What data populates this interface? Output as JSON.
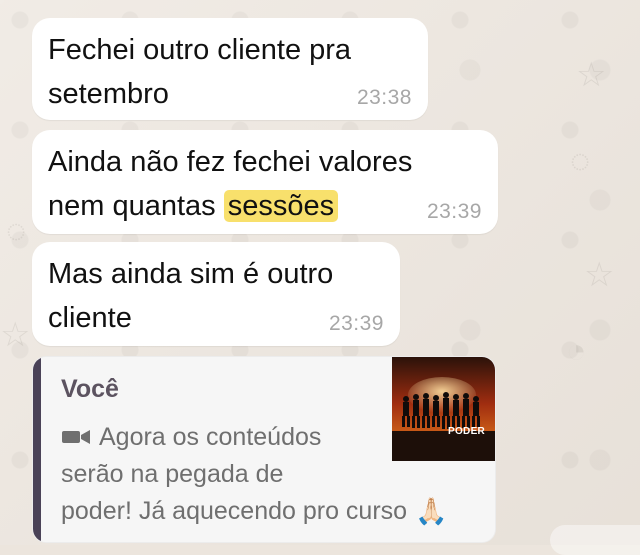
{
  "messages": [
    {
      "lines": [
        "Fechei outro cliente pra",
        "setembro"
      ],
      "time": "23:38"
    },
    {
      "line1": "Ainda não fez fechei valores",
      "line2_prefix": "nem quantas ",
      "line2_highlight": "sessões",
      "time": "23:39"
    },
    {
      "lines": [
        "Mas ainda sim é outro",
        "cliente"
      ],
      "time": "23:39"
    }
  ],
  "quoted_message": {
    "author": "Você",
    "lines": [
      "Agora os conteúdos",
      "serão na pegada de",
      "poder! Já aquecendo pro curso"
    ],
    "thumbnail_text": "PODER",
    "media_icon": "video-camera-icon",
    "emoji": "🙏🏻",
    "accent_color": "#4a4257"
  },
  "colors": {
    "chat_background": "#ece5dd",
    "bubble_background": "#ffffff",
    "highlight": "#f8e06c",
    "timestamp": "#a7a7a7"
  }
}
